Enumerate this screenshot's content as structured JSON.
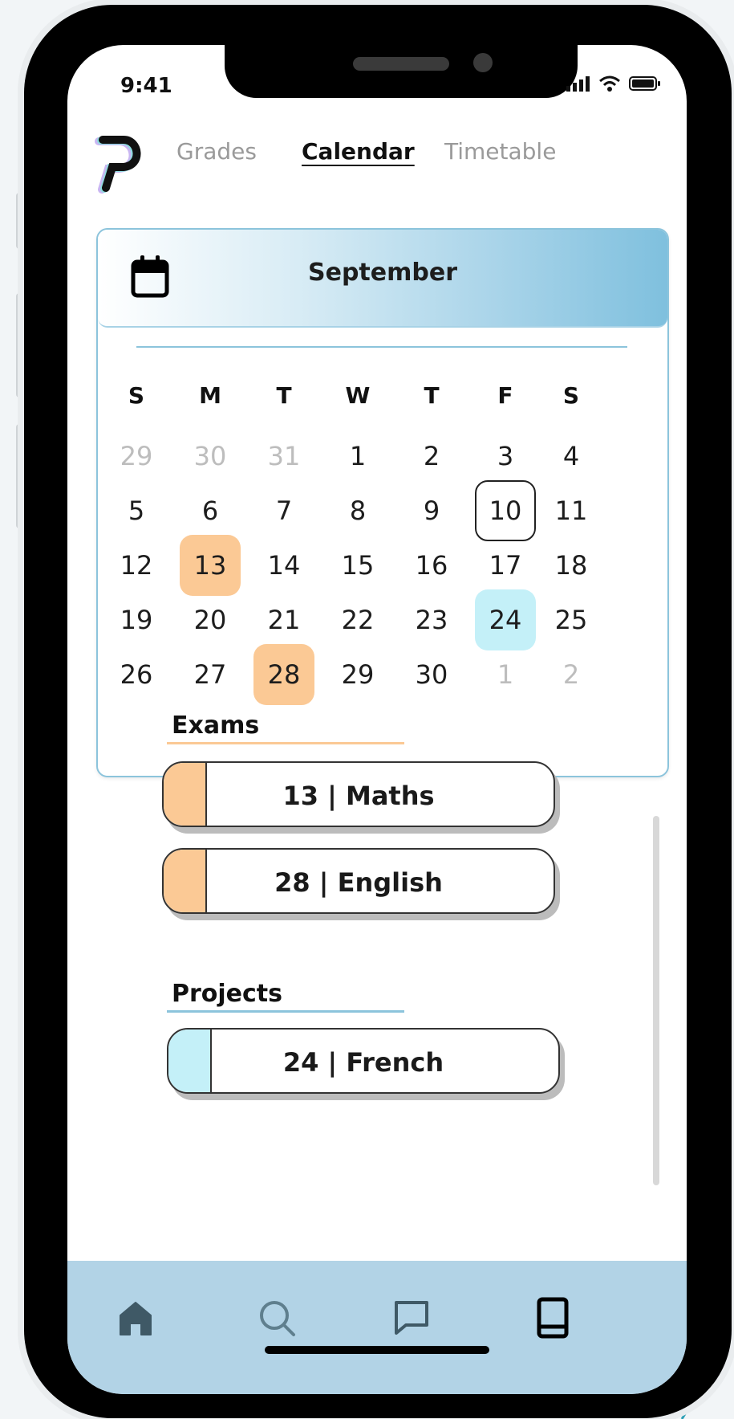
{
  "status_bar": {
    "time": "9:41"
  },
  "nav_tabs": [
    {
      "label": "Grades",
      "active": false
    },
    {
      "label": "Calendar",
      "active": true
    },
    {
      "label": "Timetable",
      "active": false
    }
  ],
  "calendar": {
    "month": "September",
    "weekdays": [
      "S",
      "M",
      "T",
      "W",
      "T",
      "F",
      "S"
    ],
    "weeks": [
      [
        {
          "d": "29",
          "muted": true
        },
        {
          "d": "30",
          "muted": true
        },
        {
          "d": "31",
          "muted": true
        },
        {
          "d": "1"
        },
        {
          "d": "2"
        },
        {
          "d": "3"
        },
        {
          "d": "4"
        }
      ],
      [
        {
          "d": "5"
        },
        {
          "d": "6"
        },
        {
          "d": "7"
        },
        {
          "d": "8"
        },
        {
          "d": "9"
        },
        {
          "d": "10",
          "today": true
        },
        {
          "d": "11"
        }
      ],
      [
        {
          "d": "12"
        },
        {
          "d": "13",
          "mark": "exam"
        },
        {
          "d": "14"
        },
        {
          "d": "15"
        },
        {
          "d": "16"
        },
        {
          "d": "17"
        },
        {
          "d": "18"
        }
      ],
      [
        {
          "d": "19"
        },
        {
          "d": "20"
        },
        {
          "d": "21"
        },
        {
          "d": "22"
        },
        {
          "d": "23"
        },
        {
          "d": "24",
          "mark": "project"
        },
        {
          "d": "25"
        }
      ],
      [
        {
          "d": "26"
        },
        {
          "d": "27"
        },
        {
          "d": "28",
          "mark": "exam"
        },
        {
          "d": "29"
        },
        {
          "d": "30"
        },
        {
          "d": "1",
          "muted": true
        },
        {
          "d": "2",
          "muted": true
        }
      ]
    ]
  },
  "exams": {
    "title": "Exams",
    "items": [
      {
        "label": "13 | Maths"
      },
      {
        "label": "28 | English"
      }
    ]
  },
  "projects": {
    "title": "Projects",
    "items": [
      {
        "label": "24 | French"
      }
    ]
  },
  "colors": {
    "exam": "#fbc995",
    "project": "#c4f0f8",
    "accent_blue": "#8cc4dc",
    "nav_bg": "#b2d3e6"
  },
  "bottom_nav": {
    "icons": [
      "home-icon",
      "search-icon",
      "chat-icon",
      "book-icon"
    ]
  }
}
